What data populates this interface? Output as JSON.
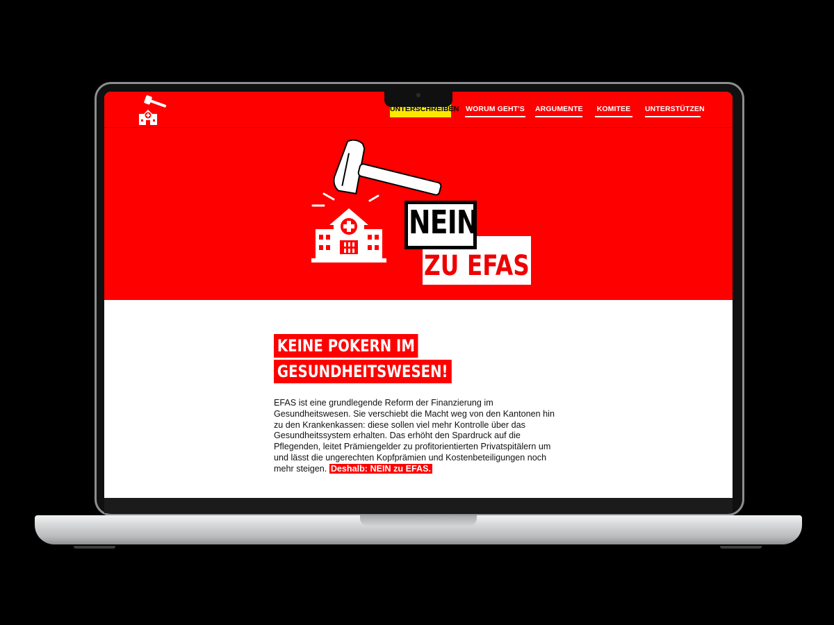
{
  "site": {
    "nav": {
      "items": [
        {
          "label": "UNTERSCHREIBEN",
          "cta": true
        },
        {
          "label": "WORUM GEHT'S"
        },
        {
          "label": "ARGUMENTE"
        },
        {
          "label": "KOMITEE"
        },
        {
          "label": "UNTERSTÜTZEN"
        }
      ]
    },
    "hero": {
      "sign_line1": "NEIN",
      "sign_line2": "ZU EFAS"
    },
    "main": {
      "headline_line1": "KEINE POKERN IM",
      "headline_line2": "GESUNDHEITSWESEN!",
      "body": "EFAS ist eine grundlegende Reform der Finanzierung im Gesundheitswesen. Sie verschiebt die Macht weg von den Kantonen hin zu den Krankenkassen: diese sollen viel mehr Kontrolle über das Gesundheitssystem erhalten. Das erhöht den Spardruck auf die Pflegenden, leitet Prämiengelder zu profitorientierten Privatspitälern um und lässt die ungerechten Kopfprämien und Kostenbeteiligungen noch mehr steigen.",
      "body_highlight": "Deshalb: NEIN zu EFAS."
    }
  },
  "colors": {
    "brand_red": "#fe0000",
    "cta_yellow": "#ffe800",
    "device_bg": "#000000"
  },
  "icons": [
    "hammer-hospital-logo-icon",
    "hammer-icon",
    "hospital-icon"
  ]
}
